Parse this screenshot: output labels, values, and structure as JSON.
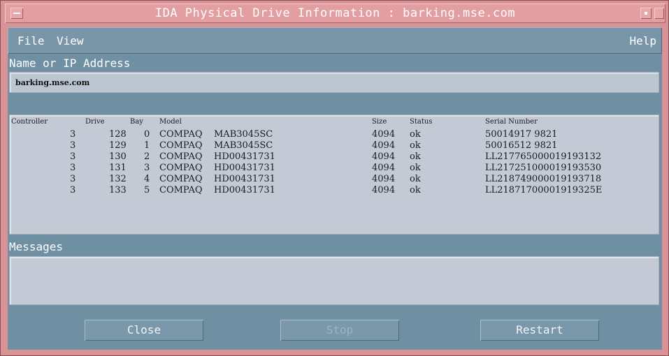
{
  "window": {
    "title": "IDA Physical Drive Information : barking.mse.com"
  },
  "menubar": {
    "file": "File",
    "view": "View",
    "help": "Help"
  },
  "address": {
    "label": "Name or IP Address",
    "value": "barking.mse.com"
  },
  "drives": {
    "headers": {
      "controller": "Controller",
      "drive": "Drive",
      "bay": "Bay",
      "model": "Model",
      "size": "Size",
      "status": "Status",
      "serial": "Serial Number"
    },
    "rows": [
      {
        "controller": "3",
        "drive": "128",
        "bay": "0",
        "vendor": "COMPAQ",
        "model": "MAB3045SC",
        "size": "4094",
        "status": "ok",
        "serial": "50014917     9821"
      },
      {
        "controller": "3",
        "drive": "129",
        "bay": "1",
        "vendor": "COMPAQ",
        "model": "MAB3045SC",
        "size": "4094",
        "status": "ok",
        "serial": "50016512     9821"
      },
      {
        "controller": "3",
        "drive": "130",
        "bay": "2",
        "vendor": "COMPAQ",
        "model": "HD00431731",
        "size": "4094",
        "status": "ok",
        "serial": "LL217765000019193132"
      },
      {
        "controller": "3",
        "drive": "131",
        "bay": "3",
        "vendor": "COMPAQ",
        "model": "HD00431731",
        "size": "4094",
        "status": "ok",
        "serial": "LL217251000019193530"
      },
      {
        "controller": "3",
        "drive": "132",
        "bay": "4",
        "vendor": "COMPAQ",
        "model": "HD00431731",
        "size": "4094",
        "status": "ok",
        "serial": "LL218749000019193718"
      },
      {
        "controller": "3",
        "drive": "133",
        "bay": "5",
        "vendor": "COMPAQ",
        "model": "HD00431731",
        "size": "4094",
        "status": "ok",
        "serial": "LL21871700001919325E"
      }
    ]
  },
  "messages": {
    "label": "Messages",
    "content": ""
  },
  "buttons": {
    "close": "Close",
    "stop": "Stop",
    "restart": "Restart"
  }
}
